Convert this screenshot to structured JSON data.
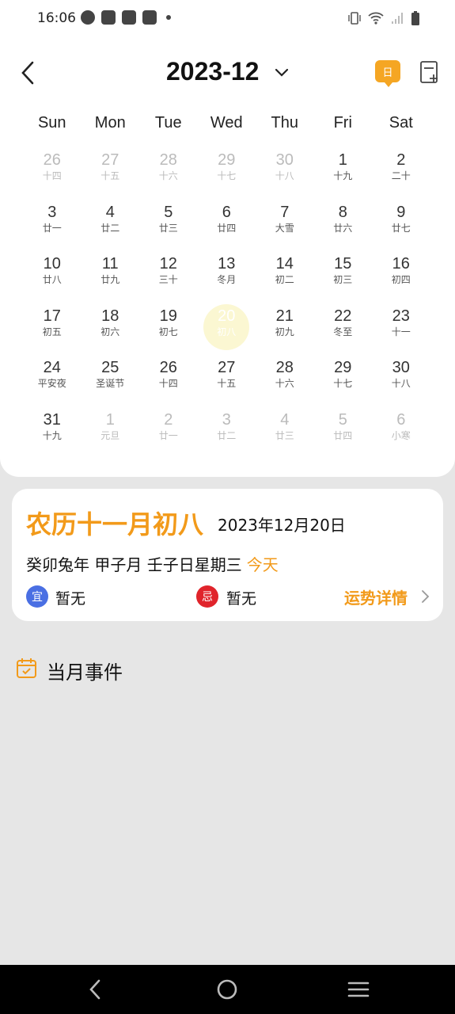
{
  "status": {
    "time": "16:06"
  },
  "header": {
    "month": "2023-12",
    "today_btn": "日"
  },
  "weekdays": [
    "Sun",
    "Mon",
    "Tue",
    "Wed",
    "Thu",
    "Fri",
    "Sat"
  ],
  "weeks": [
    [
      {
        "d": "26",
        "l": "十四",
        "m": true
      },
      {
        "d": "27",
        "l": "十五",
        "m": true
      },
      {
        "d": "28",
        "l": "十六",
        "m": true
      },
      {
        "d": "29",
        "l": "十七",
        "m": true
      },
      {
        "d": "30",
        "l": "十八",
        "m": true
      },
      {
        "d": "1",
        "l": "十九"
      },
      {
        "d": "2",
        "l": "二十"
      }
    ],
    [
      {
        "d": "3",
        "l": "廿一"
      },
      {
        "d": "4",
        "l": "廿二"
      },
      {
        "d": "5",
        "l": "廿三"
      },
      {
        "d": "6",
        "l": "廿四"
      },
      {
        "d": "7",
        "l": "大雪"
      },
      {
        "d": "8",
        "l": "廿六"
      },
      {
        "d": "9",
        "l": "廿七"
      }
    ],
    [
      {
        "d": "10",
        "l": "廿八"
      },
      {
        "d": "11",
        "l": "廿九"
      },
      {
        "d": "12",
        "l": "三十"
      },
      {
        "d": "13",
        "l": "冬月"
      },
      {
        "d": "14",
        "l": "初二"
      },
      {
        "d": "15",
        "l": "初三"
      },
      {
        "d": "16",
        "l": "初四"
      }
    ],
    [
      {
        "d": "17",
        "l": "初五"
      },
      {
        "d": "18",
        "l": "初六"
      },
      {
        "d": "19",
        "l": "初七"
      },
      {
        "d": "20",
        "l": "初八",
        "t": true
      },
      {
        "d": "21",
        "l": "初九"
      },
      {
        "d": "22",
        "l": "冬至"
      },
      {
        "d": "23",
        "l": "十一"
      }
    ],
    [
      {
        "d": "24",
        "l": "平安夜"
      },
      {
        "d": "25",
        "l": "圣诞节"
      },
      {
        "d": "26",
        "l": "十四"
      },
      {
        "d": "27",
        "l": "十五"
      },
      {
        "d": "28",
        "l": "十六"
      },
      {
        "d": "29",
        "l": "十七"
      },
      {
        "d": "30",
        "l": "十八"
      }
    ],
    [
      {
        "d": "31",
        "l": "十九"
      },
      {
        "d": "1",
        "l": "元旦",
        "m": true
      },
      {
        "d": "2",
        "l": "廿一",
        "m": true
      },
      {
        "d": "3",
        "l": "廿二",
        "m": true
      },
      {
        "d": "4",
        "l": "廿三",
        "m": true
      },
      {
        "d": "5",
        "l": "廿四",
        "m": true
      },
      {
        "d": "6",
        "l": "小寒",
        "m": true
      }
    ]
  ],
  "info": {
    "lunar_title": "农历十一月初八",
    "solar_date": "2023年12月20日",
    "ganzhi": "癸卯兔年 甲子月 壬子日星期三",
    "today": "今天",
    "yi_badge": "宜",
    "yi_text": "暂无",
    "ji_badge": "忌",
    "ji_text": "暂无",
    "fortune": "运势详情"
  },
  "events": {
    "title": "当月事件"
  },
  "colors": {
    "accent": "#f29a1a",
    "yi": "#4a6fe3",
    "ji": "#e0242b",
    "today_highlight": "#fbf7d2"
  }
}
